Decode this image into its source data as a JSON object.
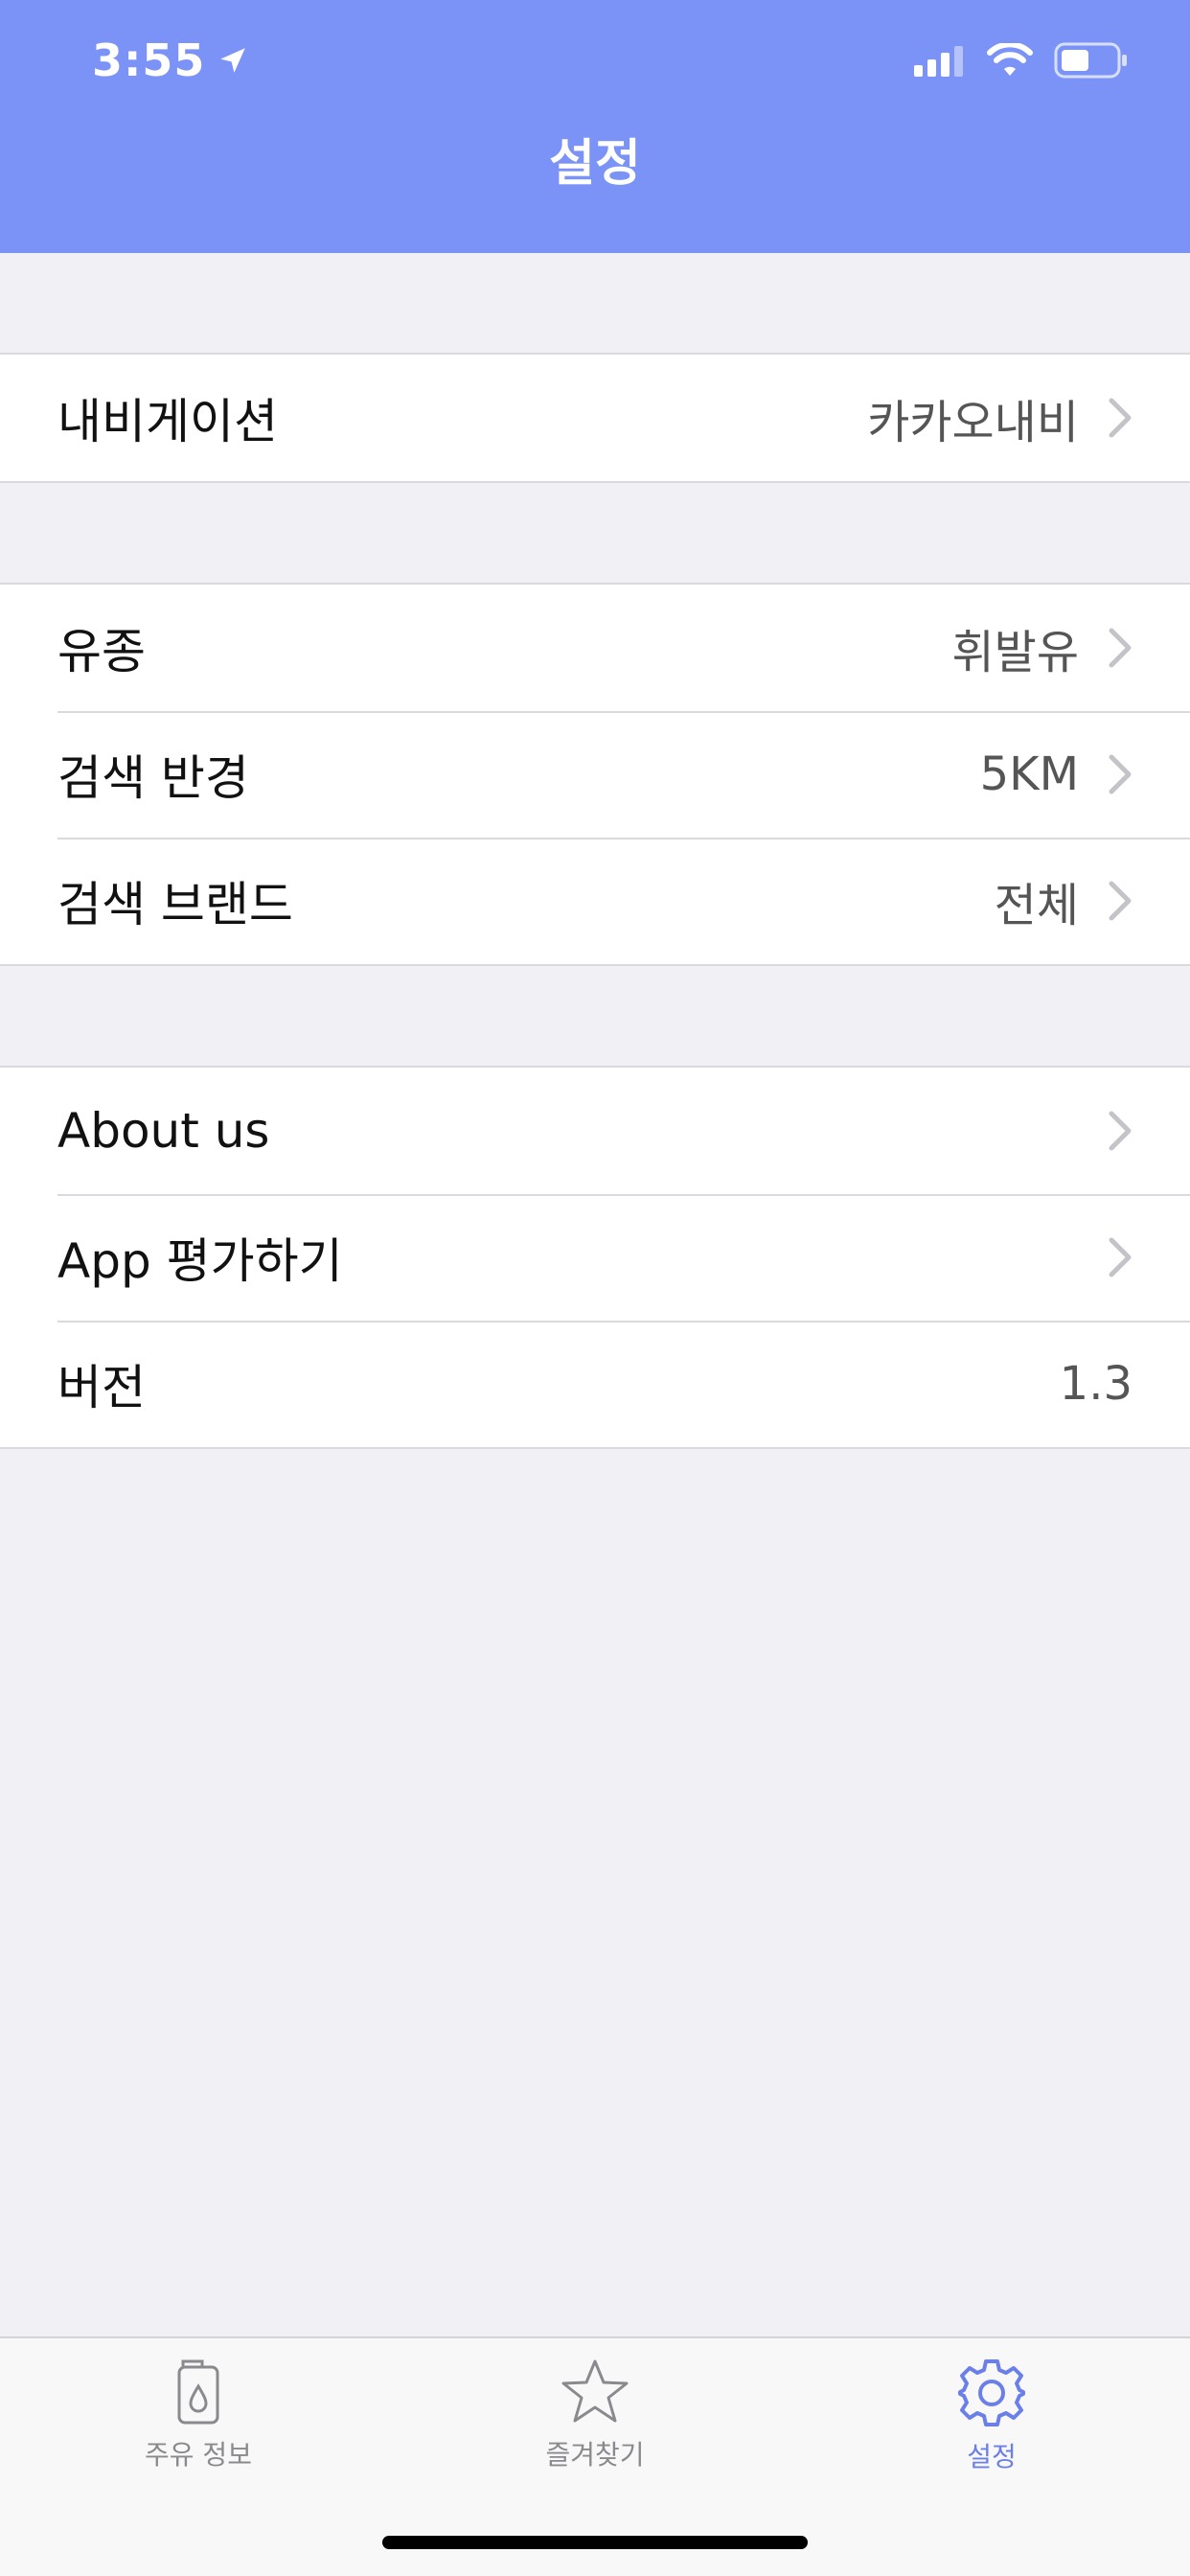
{
  "status": {
    "time": "3:55"
  },
  "navbar": {
    "title": "설정"
  },
  "groups": [
    {
      "rows": [
        {
          "label": "내비게이션",
          "value": "카카오내비"
        }
      ]
    },
    {
      "rows": [
        {
          "label": "유종",
          "value": "휘발유"
        },
        {
          "label": "검색 반경",
          "value": "5KM"
        },
        {
          "label": "검색 브랜드",
          "value": "전체"
        }
      ]
    },
    {
      "rows": [
        {
          "label": "About us",
          "value": ""
        },
        {
          "label": "App 평가하기",
          "value": ""
        },
        {
          "label": "버전",
          "value": "1.3"
        }
      ]
    }
  ],
  "tabbar": {
    "tabs": [
      {
        "label": "주유 정보",
        "icon": "fuel-icon"
      },
      {
        "label": "즐겨찾기",
        "icon": "star-icon"
      },
      {
        "label": "설정",
        "icon": "gear-icon"
      }
    ],
    "active": "설정"
  },
  "colors": {
    "header": "#7b93f7",
    "active_tab": "#6b7fe8",
    "background": "#f0f0f5"
  }
}
